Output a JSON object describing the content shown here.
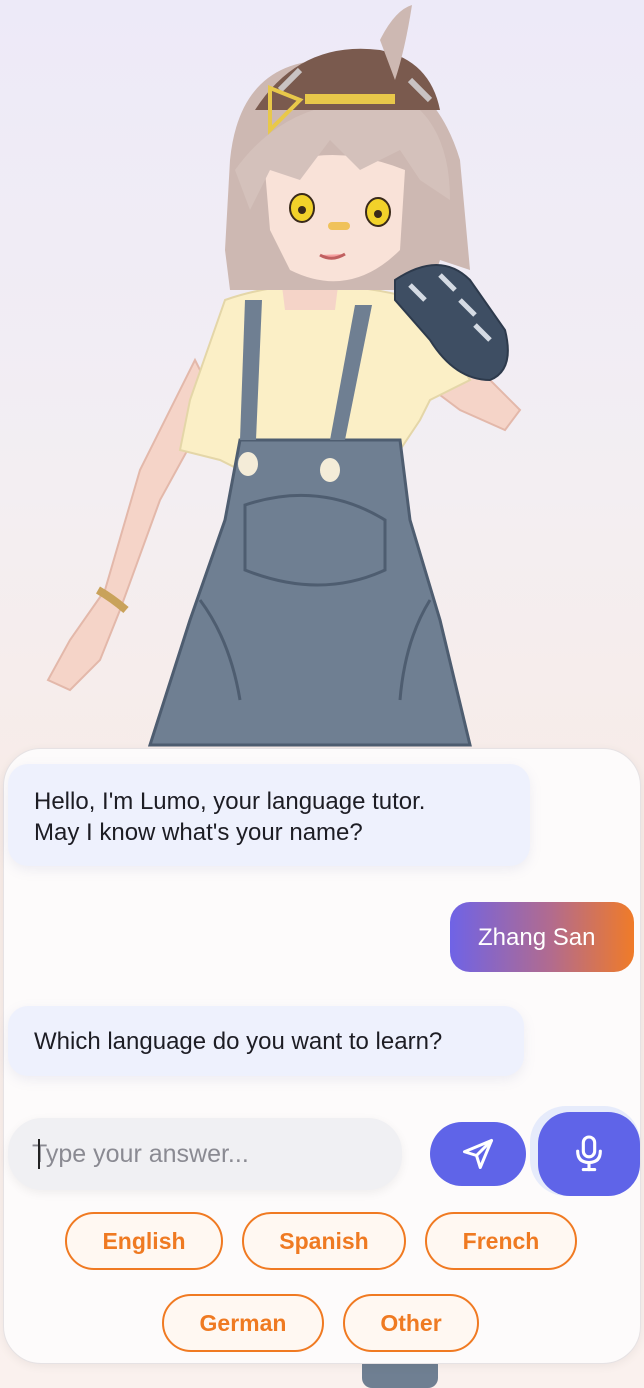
{
  "tutor": {
    "name": "Lumo"
  },
  "messages": [
    {
      "sender": "bot",
      "line1": "Hello, I'm Lumo, your language tutor.",
      "line2": "May I know what's your name?"
    },
    {
      "sender": "user",
      "text": "Zhang San"
    },
    {
      "sender": "bot",
      "text": "Which language do you want to learn?"
    }
  ],
  "composer": {
    "placeholder": "Type your answer...",
    "value": "",
    "send_icon": "send-icon",
    "mic_icon": "microphone-icon"
  },
  "language_options": [
    "English",
    "Spanish",
    "French",
    "German",
    "Other"
  ],
  "colors": {
    "accent": "#5f64e8",
    "chip_orange": "#f07a22",
    "bot_bubble": "#eef1fd",
    "user_gradient_start": "#6f63e6",
    "user_gradient_end": "#f07b28"
  }
}
